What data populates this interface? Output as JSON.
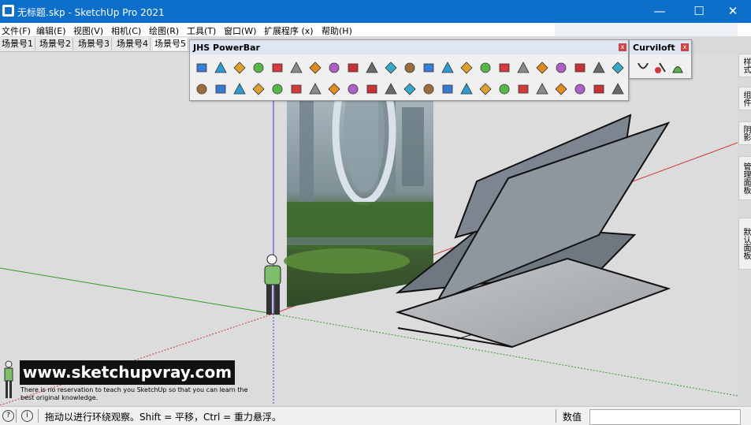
{
  "window": {
    "title": "无标题.skp - SketchUp Pro 2021",
    "minimize": "—",
    "maximize": "☐",
    "close": "✕"
  },
  "menu": [
    "文件(F)",
    "编辑(E)",
    "视图(V)",
    "相机(C)",
    "绘图(R)",
    "工具(T)",
    "窗口(W)",
    "扩展程序 (x)",
    "帮助(H)"
  ],
  "scenes": [
    "场景号1",
    "场景号2",
    "场景号3",
    "场景号4",
    "场景号5"
  ],
  "active_scene": "场景号5",
  "right_panels": [
    "样式",
    "组件",
    "阴影",
    "管理面板",
    "默认面板"
  ],
  "toolbars": {
    "powerbar": {
      "title": "JHS PowerBar",
      "close": "x"
    },
    "curviloft": {
      "title": "Curviloft",
      "close": "x"
    }
  },
  "tool_colors": [
    "#3a7bd5",
    "#2e9bd6",
    "#e0a030",
    "#58b847",
    "#d33a3a",
    "#8a8a8a",
    "#e08a20",
    "#b05ec8",
    "#c8333a",
    "#6a6a6a",
    "#38a7c9",
    "#9a6d3a"
  ],
  "watermark": {
    "site": "www.sketchupvray.com",
    "tagline": "There is no reservation to teach you SketchUp so that you can learn the best original knowledge."
  },
  "status": {
    "hint": "拖动以进行环绕观察。Shift = 平移，Ctrl = 重力悬浮。",
    "value_label": "数值",
    "value": ""
  },
  "colors": {
    "titlebar": "#0c6fc9",
    "viewport": "#dcdcdc",
    "axis_red": "#c83a3a",
    "axis_green": "#2e9a2e",
    "axis_blue": "#3a3ac8"
  }
}
